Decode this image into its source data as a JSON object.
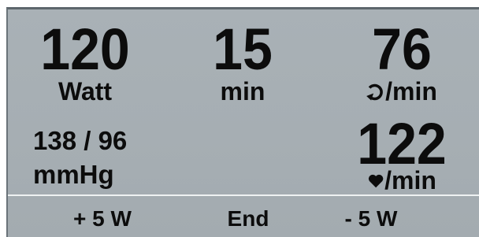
{
  "power": {
    "value": "120",
    "unit": "Watt"
  },
  "time": {
    "value": "15",
    "unit": "min"
  },
  "cadence": {
    "value": "76",
    "icon": "rotation-icon",
    "unit": "/min"
  },
  "blood_pressure": {
    "value": "138 /  96",
    "unit": "mmHg"
  },
  "heart_rate": {
    "value": "122",
    "icon": "heart-icon",
    "unit": "/min"
  },
  "softkeys": {
    "increase": "+ 5 W",
    "end": "End",
    "decrease": "- 5 W"
  }
}
